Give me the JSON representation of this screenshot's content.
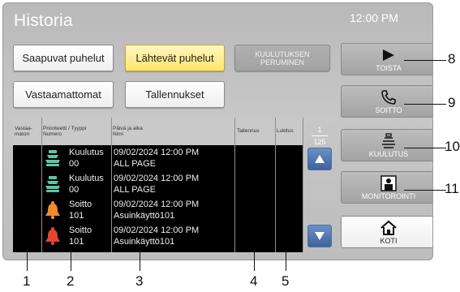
{
  "header": {
    "title": "Historia",
    "time": "12:00 PM"
  },
  "filters": {
    "incoming": "Saapuvat puhelut",
    "outgoing": "Lähtevät puhelut",
    "cancel_line1": "KUULUTUKSEN",
    "cancel_line2": "PERUMINEN",
    "unanswered": "Vastaamattomat",
    "recordings": "Tallennukset"
  },
  "table": {
    "headers": {
      "unanswered_1": "Vastaa-",
      "unanswered_2": "maton",
      "priority_1": "Prioriteetti / Tyyppi",
      "priority_2": "Numero",
      "date_1": "Päivä ja aika",
      "date_2": "Nimi",
      "recording": "Tallennus",
      "locked": "Lukitus"
    },
    "rows": [
      {
        "type": "Kuulutus",
        "number": "00",
        "datetime": "09/02/2024 12:00 PM",
        "name": "ALL PAGE",
        "icon": "paging-icon"
      },
      {
        "type": "Kuulutus",
        "number": "00",
        "datetime": "09/02/2024 12:00 PM",
        "name": "ALL PAGE",
        "icon": "paging-icon"
      },
      {
        "type": "Soitto",
        "number": "101",
        "datetime": "09/02/2024 12:00 PM",
        "name": "Asuinkäyttö101",
        "icon": "bell-icon"
      },
      {
        "type": "Soitto",
        "number": "101",
        "datetime": "09/02/2024 12:00 PM",
        "name": "Asuinkäyttö101",
        "icon": "bell-icon"
      }
    ],
    "pager": {
      "current": "1",
      "total": "125"
    }
  },
  "side": {
    "play": "TOISTA",
    "call": "SOITTO",
    "page": "KUULUTUS",
    "monitor": "MONITOROINTI",
    "home": "KOTI"
  },
  "callouts": [
    "1",
    "2",
    "3",
    "4",
    "5",
    "8",
    "9",
    "10",
    "11"
  ],
  "colors": {
    "active_yellow": "#ffe56a",
    "nav_blue": "#3f62a0",
    "paging_green": "#5fc6a3",
    "bell_orange": "#f28a2e",
    "bell_red": "#e2462c"
  }
}
